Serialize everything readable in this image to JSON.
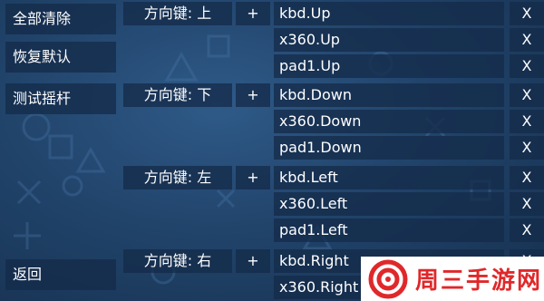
{
  "side": {
    "clear_all": "全部清除",
    "restore_default": "恢复默认",
    "test_stick": "测试摇杆",
    "back": "返回"
  },
  "mappings": [
    {
      "label": "方向键: 上",
      "plus": "+",
      "bindings": [
        "kbd.Up",
        "x360.Up",
        "pad1.Up"
      ]
    },
    {
      "label": "方向键: 下",
      "plus": "+",
      "bindings": [
        "kbd.Down",
        "x360.Down",
        "pad1.Down"
      ]
    },
    {
      "label": "方向键: 左",
      "plus": "+",
      "bindings": [
        "kbd.Left",
        "x360.Left",
        "pad1.Left"
      ]
    },
    {
      "label": "方向键: 右",
      "plus": "+",
      "bindings": [
        "kbd.Right",
        "x360.Right"
      ]
    }
  ],
  "remove_label": "X",
  "watermark": {
    "text": "周三手游网",
    "color": "#e0282a"
  },
  "colors": {
    "background": "#21446b",
    "panel": "#142c4a"
  }
}
